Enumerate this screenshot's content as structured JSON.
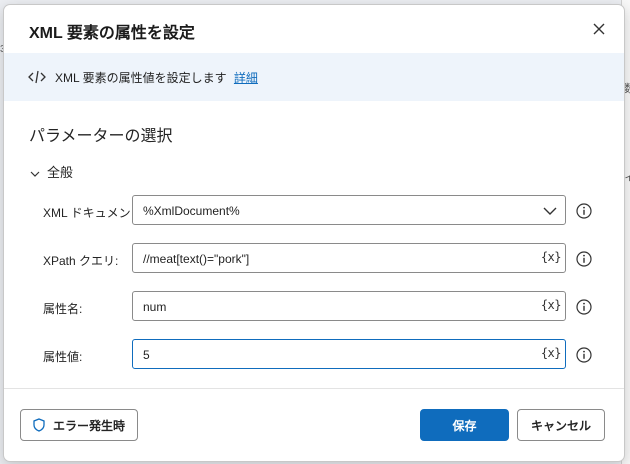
{
  "dialog": {
    "title": "XML 要素の属性を設定",
    "info_text": "XML 要素の属性値を設定します",
    "info_link": "詳細",
    "section_title": "パラメーターの選択",
    "group_label": "全般"
  },
  "fields": {
    "xml_document": {
      "label": "XML ドキュメント:",
      "value": "%XmlDocument%"
    },
    "xpath_query": {
      "label": "XPath クエリ:",
      "value": "//meat[text()=\"pork\"]",
      "var_button": "{x}"
    },
    "attribute_name": {
      "label": "属性名:",
      "value": "num",
      "var_button": "{x}"
    },
    "attribute_value": {
      "label": "属性値:",
      "value": "5",
      "var_button": "{x}"
    }
  },
  "footer": {
    "on_error_label": "エラー発生時",
    "save_label": "保存",
    "cancel_label": "キャンセル"
  },
  "colors": {
    "accent": "#0f6cbd",
    "info_bar_bg": "#eef4fb"
  }
}
